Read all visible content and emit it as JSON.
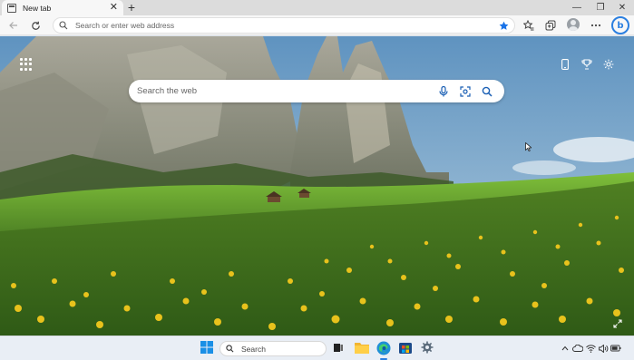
{
  "tab": {
    "title": "New tab",
    "close": "✕",
    "new": "+"
  },
  "window": {
    "minimize": "—",
    "maximize": "❐",
    "close": "✕"
  },
  "address_bar": {
    "placeholder": "Search or enter web address"
  },
  "new_tab_page": {
    "search_placeholder": "Search the web"
  },
  "taskbar": {
    "search_placeholder": "Search"
  },
  "colors": {
    "accent": "#2b7fe0",
    "favorite_star": "#1a73e8"
  }
}
